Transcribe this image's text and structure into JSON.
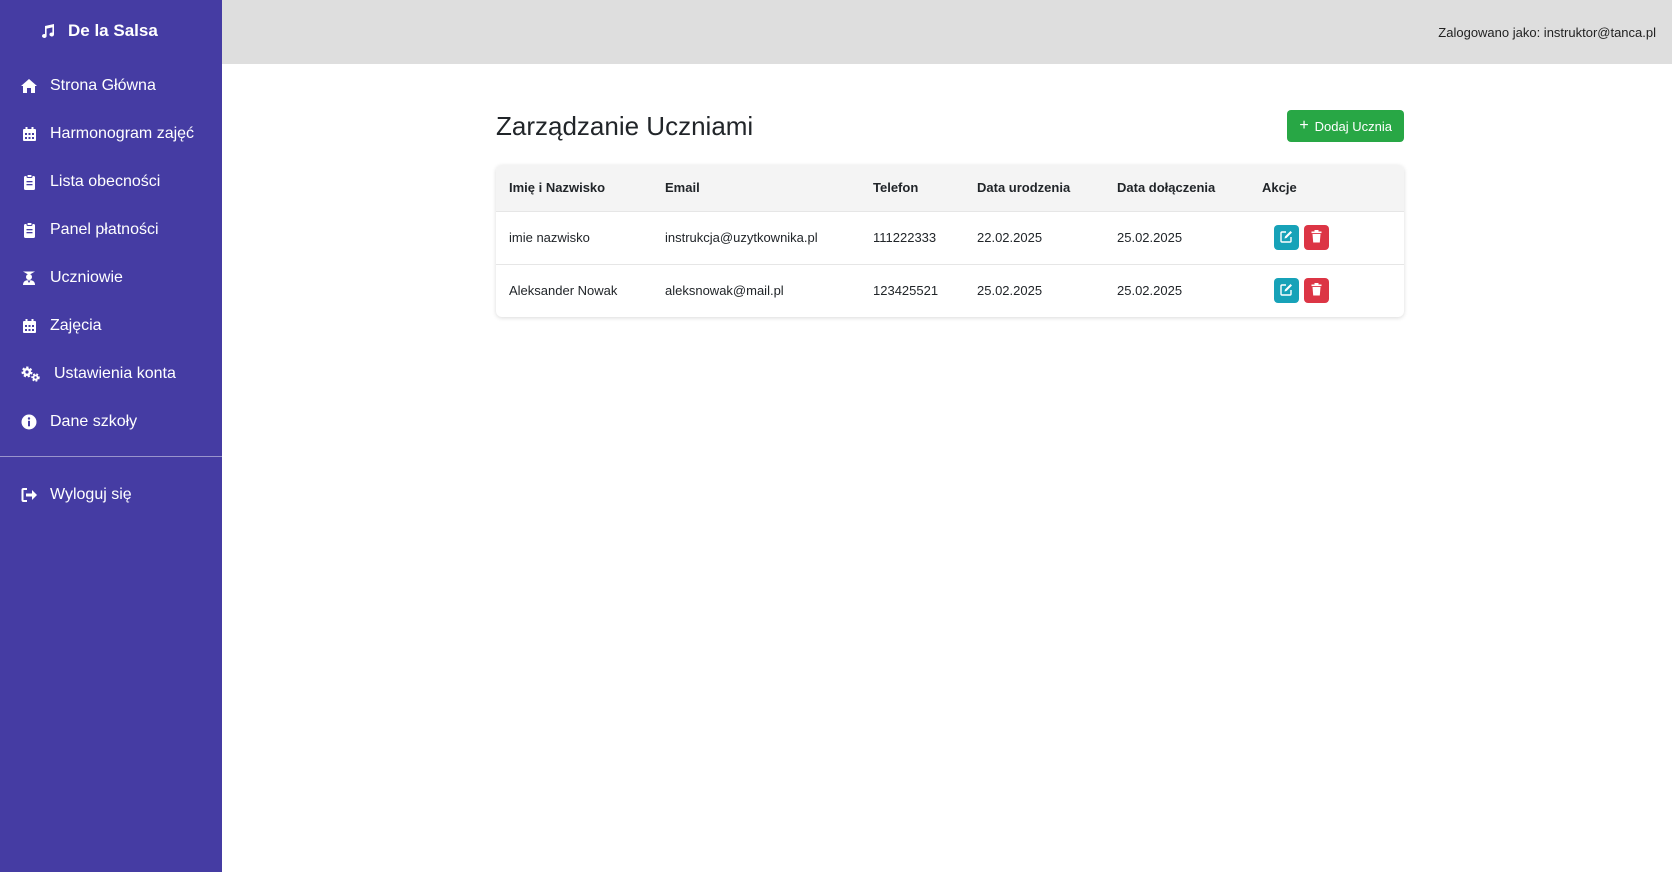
{
  "app": {
    "brand": "De la Salsa"
  },
  "sidebar": {
    "items": [
      {
        "label": "Strona Główna",
        "icon": "home-icon"
      },
      {
        "label": "Harmonogram zajęć",
        "icon": "calendar-icon"
      },
      {
        "label": "Lista obecności",
        "icon": "clipboard-icon"
      },
      {
        "label": "Panel płatności",
        "icon": "clipboard-icon"
      },
      {
        "label": "Uczniowie",
        "icon": "graduate-icon"
      },
      {
        "label": "Zajęcia",
        "icon": "calendar-icon"
      },
      {
        "label": "Ustawienia konta",
        "icon": "gears-icon"
      },
      {
        "label": "Dane szkoły",
        "icon": "info-icon"
      }
    ],
    "logout": {
      "label": "Wyloguj się",
      "icon": "sign-out-icon"
    }
  },
  "topbar": {
    "user_text": "Zalogowano jako: instruktor@tanca.pl"
  },
  "main": {
    "title": "Zarządzanie Uczniami",
    "add_button": "Dodaj Ucznia",
    "columns": [
      "Imię i Nazwisko",
      "Email",
      "Telefon",
      "Data urodzenia",
      "Data dołączenia",
      "Akcje"
    ],
    "rows": [
      {
        "name": "imie nazwisko",
        "email": "instrukcja@uzytkownika.pl",
        "phone": "111222333",
        "birth": "22.02.2025",
        "joined": "25.02.2025"
      },
      {
        "name": "Aleksander Nowak",
        "email": "aleksnowak@mail.pl",
        "phone": "123425521",
        "birth": "25.02.2025",
        "joined": "25.02.2025"
      }
    ]
  },
  "colors": {
    "sidebar": "#453ca3",
    "topbar": "#dedede",
    "add_button": "#28a745",
    "edit_button": "#17a2b8",
    "delete_button": "#dc3545"
  }
}
